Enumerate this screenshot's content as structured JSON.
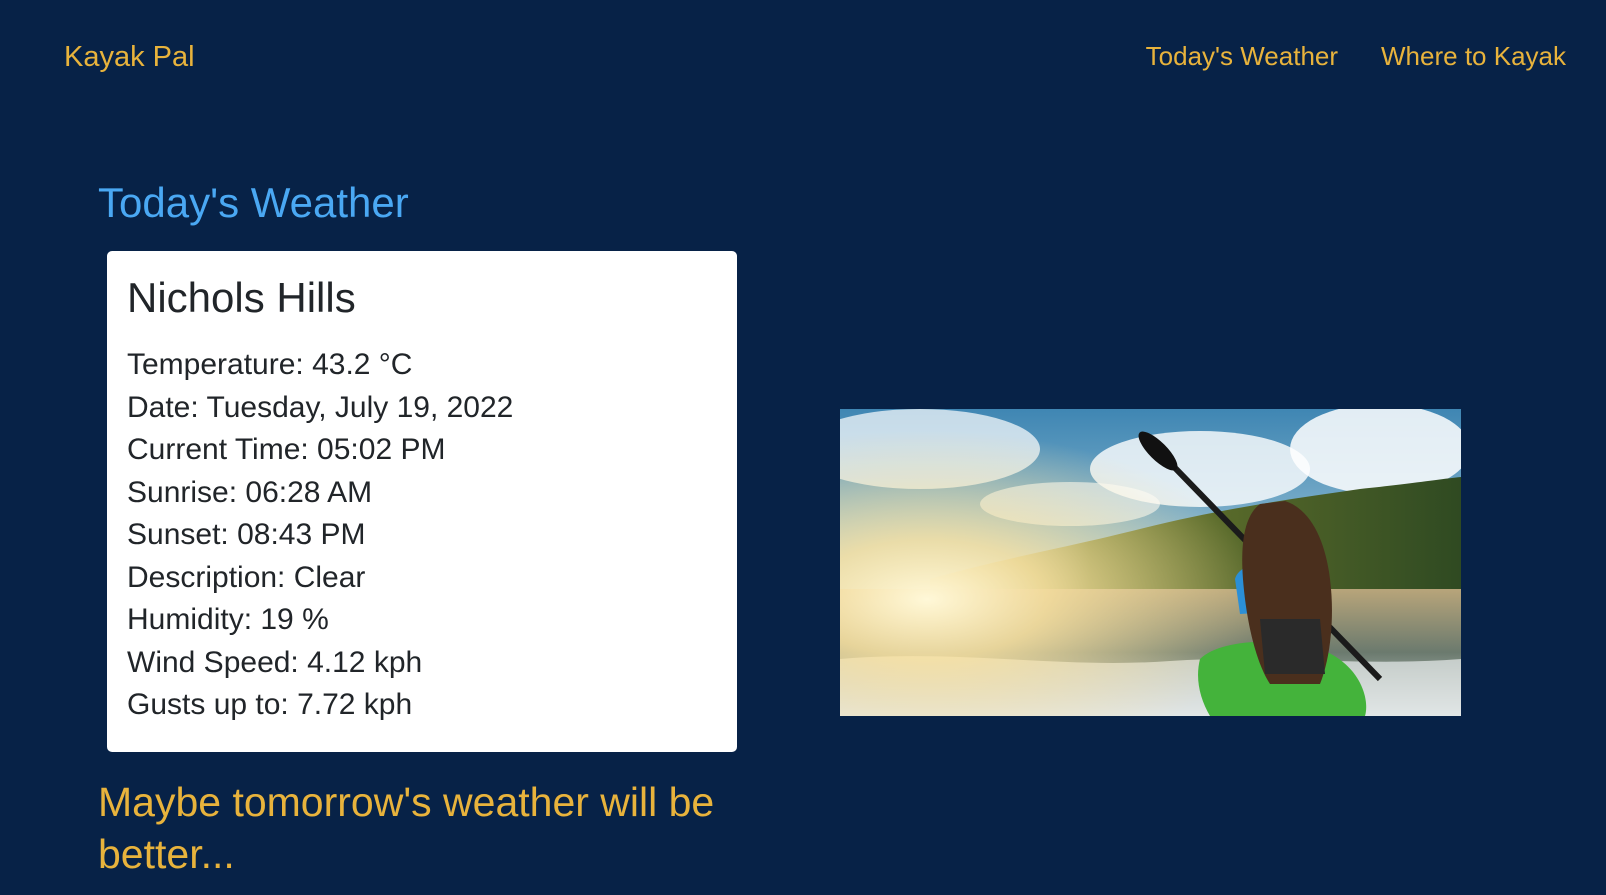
{
  "header": {
    "brand": "Kayak Pal",
    "nav": [
      "Today's Weather",
      "Where to Kayak"
    ]
  },
  "main": {
    "title": "Today's Weather",
    "card": {
      "location": "Nichols Hills",
      "rows": [
        "Temperature: 43.2 °C",
        "Date: Tuesday, July 19, 2022",
        "Current Time: 05:02 PM",
        "Sunrise: 06:28 AM",
        "Sunset: 08:43 PM",
        "Description: Clear",
        "Humidity: 19 %",
        "Wind Speed: 4.12 kph",
        "Gusts up to: 7.72 kph"
      ]
    },
    "message": "Maybe tomorrow's weather will be better..."
  },
  "colors": {
    "background": "#072247",
    "accent": "#e8b33c",
    "title": "#4aa8f3"
  }
}
